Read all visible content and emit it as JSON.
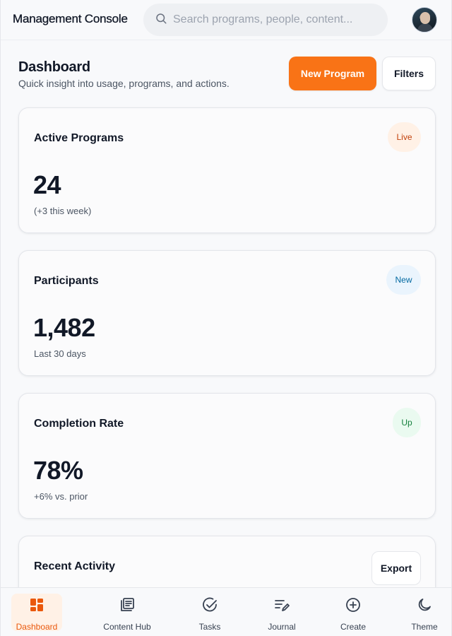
{
  "header": {
    "app_title": "Management Console",
    "search_placeholder": "Search programs, people, content..."
  },
  "page": {
    "title": "Dashboard",
    "subtitle": "Quick insight into usage, programs, and actions.",
    "primary_button": "New Program",
    "secondary_button": "Filters"
  },
  "cards": [
    {
      "title": "Active Programs",
      "badge": "Live",
      "badge_color": "#c2410c",
      "badge_bg": "#fff1e6",
      "metric": "24",
      "note": "(+3 this week)"
    },
    {
      "title": "Participants",
      "badge": "New",
      "badge_color": "#0369a1",
      "badge_bg": "#eaf4fd",
      "metric": "1,482",
      "note": "Last 30 days"
    },
    {
      "title": "Completion Rate",
      "badge": "Up",
      "badge_color": "#15803d",
      "badge_bg": "#eafaf0",
      "metric": "78%",
      "note": "+6% vs. prior"
    }
  ],
  "activity": {
    "title": "Recent Activity",
    "export_label": "Export"
  },
  "nav": {
    "items": [
      {
        "label": "Dashboard",
        "icon": "dashboard-icon",
        "active": true
      },
      {
        "label": "Content Hub",
        "icon": "content-hub-icon",
        "active": false
      },
      {
        "label": "Tasks",
        "icon": "tasks-check-icon",
        "active": false
      },
      {
        "label": "Journal",
        "icon": "journal-icon",
        "active": false
      },
      {
        "label": "Create",
        "icon": "plus-circle-icon",
        "active": false
      },
      {
        "label": "Theme",
        "icon": "moon-icon",
        "active": false
      }
    ]
  },
  "colors": {
    "accent": "#f97316",
    "accent_dark": "#ea580c",
    "text": "#111827",
    "muted": "#4b5563"
  }
}
